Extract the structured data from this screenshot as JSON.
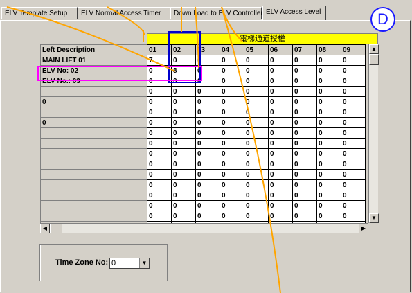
{
  "tabs": [
    {
      "label": "ELV Template Setup"
    },
    {
      "label": "ELV Normal Access Timer"
    },
    {
      "label": "Down Load to ELV Controller"
    },
    {
      "label": "ELV Access Level"
    }
  ],
  "badge": {
    "letter": "D"
  },
  "grid": {
    "group_header": "電梯通道授權",
    "desc_header": "Left Description",
    "columns": [
      "01",
      "02",
      "03",
      "04",
      "05",
      "06",
      "07",
      "08",
      "09"
    ],
    "rows": [
      {
        "desc": "MAIN LIFT 01",
        "values": [
          "7",
          "0",
          "0",
          "0",
          "0",
          "0",
          "0",
          "0",
          "0"
        ]
      },
      {
        "desc": "ELV No: 02",
        "values": [
          "0",
          "8",
          "0",
          "0",
          "0",
          "0",
          "0",
          "0",
          "0"
        ]
      },
      {
        "desc": "ELV No.: 03",
        "values": [
          "0",
          "0",
          "0",
          "0",
          "0",
          "0",
          "0",
          "0",
          "0"
        ]
      },
      {
        "desc": "",
        "values": [
          "0",
          "0",
          "0",
          "0",
          "0",
          "0",
          "0",
          "0",
          "0"
        ]
      },
      {
        "desc": "0",
        "values": [
          "0",
          "0",
          "0",
          "0",
          "0",
          "0",
          "0",
          "0",
          "0"
        ]
      },
      {
        "desc": "",
        "values": [
          "0",
          "0",
          "0",
          "0",
          "0",
          "0",
          "0",
          "0",
          "0"
        ]
      },
      {
        "desc": "0",
        "values": [
          "0",
          "0",
          "0",
          "0",
          "0",
          "0",
          "0",
          "0",
          "0"
        ]
      },
      {
        "desc": "",
        "values": [
          "0",
          "0",
          "0",
          "0",
          "0",
          "0",
          "0",
          "0",
          "0"
        ]
      },
      {
        "desc": "",
        "values": [
          "0",
          "0",
          "0",
          "0",
          "0",
          "0",
          "0",
          "0",
          "0"
        ]
      },
      {
        "desc": "",
        "values": [
          "0",
          "0",
          "0",
          "0",
          "0",
          "0",
          "0",
          "0",
          "0"
        ]
      },
      {
        "desc": "",
        "values": [
          "0",
          "0",
          "0",
          "0",
          "0",
          "0",
          "0",
          "0",
          "0"
        ]
      },
      {
        "desc": "",
        "values": [
          "0",
          "0",
          "0",
          "0",
          "0",
          "0",
          "0",
          "0",
          "0"
        ]
      },
      {
        "desc": "",
        "values": [
          "0",
          "0",
          "0",
          "0",
          "0",
          "0",
          "0",
          "0",
          "0"
        ]
      },
      {
        "desc": "",
        "values": [
          "0",
          "0",
          "0",
          "0",
          "0",
          "0",
          "0",
          "0",
          "0"
        ]
      },
      {
        "desc": "",
        "values": [
          "0",
          "0",
          "0",
          "0",
          "0",
          "0",
          "0",
          "0",
          "0"
        ]
      },
      {
        "desc": "",
        "values": [
          "0",
          "0",
          "0",
          "0",
          "0",
          "0",
          "0",
          "0",
          "0"
        ]
      },
      {
        "desc": "",
        "values": [
          "0",
          "0",
          "0",
          "0",
          "0",
          "0",
          "0",
          "0",
          "0"
        ]
      }
    ]
  },
  "time_zone": {
    "label": "Time Zone No:",
    "value": "0"
  },
  "icons": {
    "scroll_up": "up-arrow-icon",
    "scroll_down": "down-arrow-icon",
    "scroll_left": "left-arrow-icon",
    "scroll_right": "right-arrow-icon",
    "dropdown": "chevron-down-icon"
  },
  "colors": {
    "header_yellow": "#ffff00",
    "highlight_blue": "#0000cc",
    "highlight_magenta": "#ff00ff",
    "annotation_orange": "#ffa500",
    "badge_blue": "#1a1aff"
  }
}
